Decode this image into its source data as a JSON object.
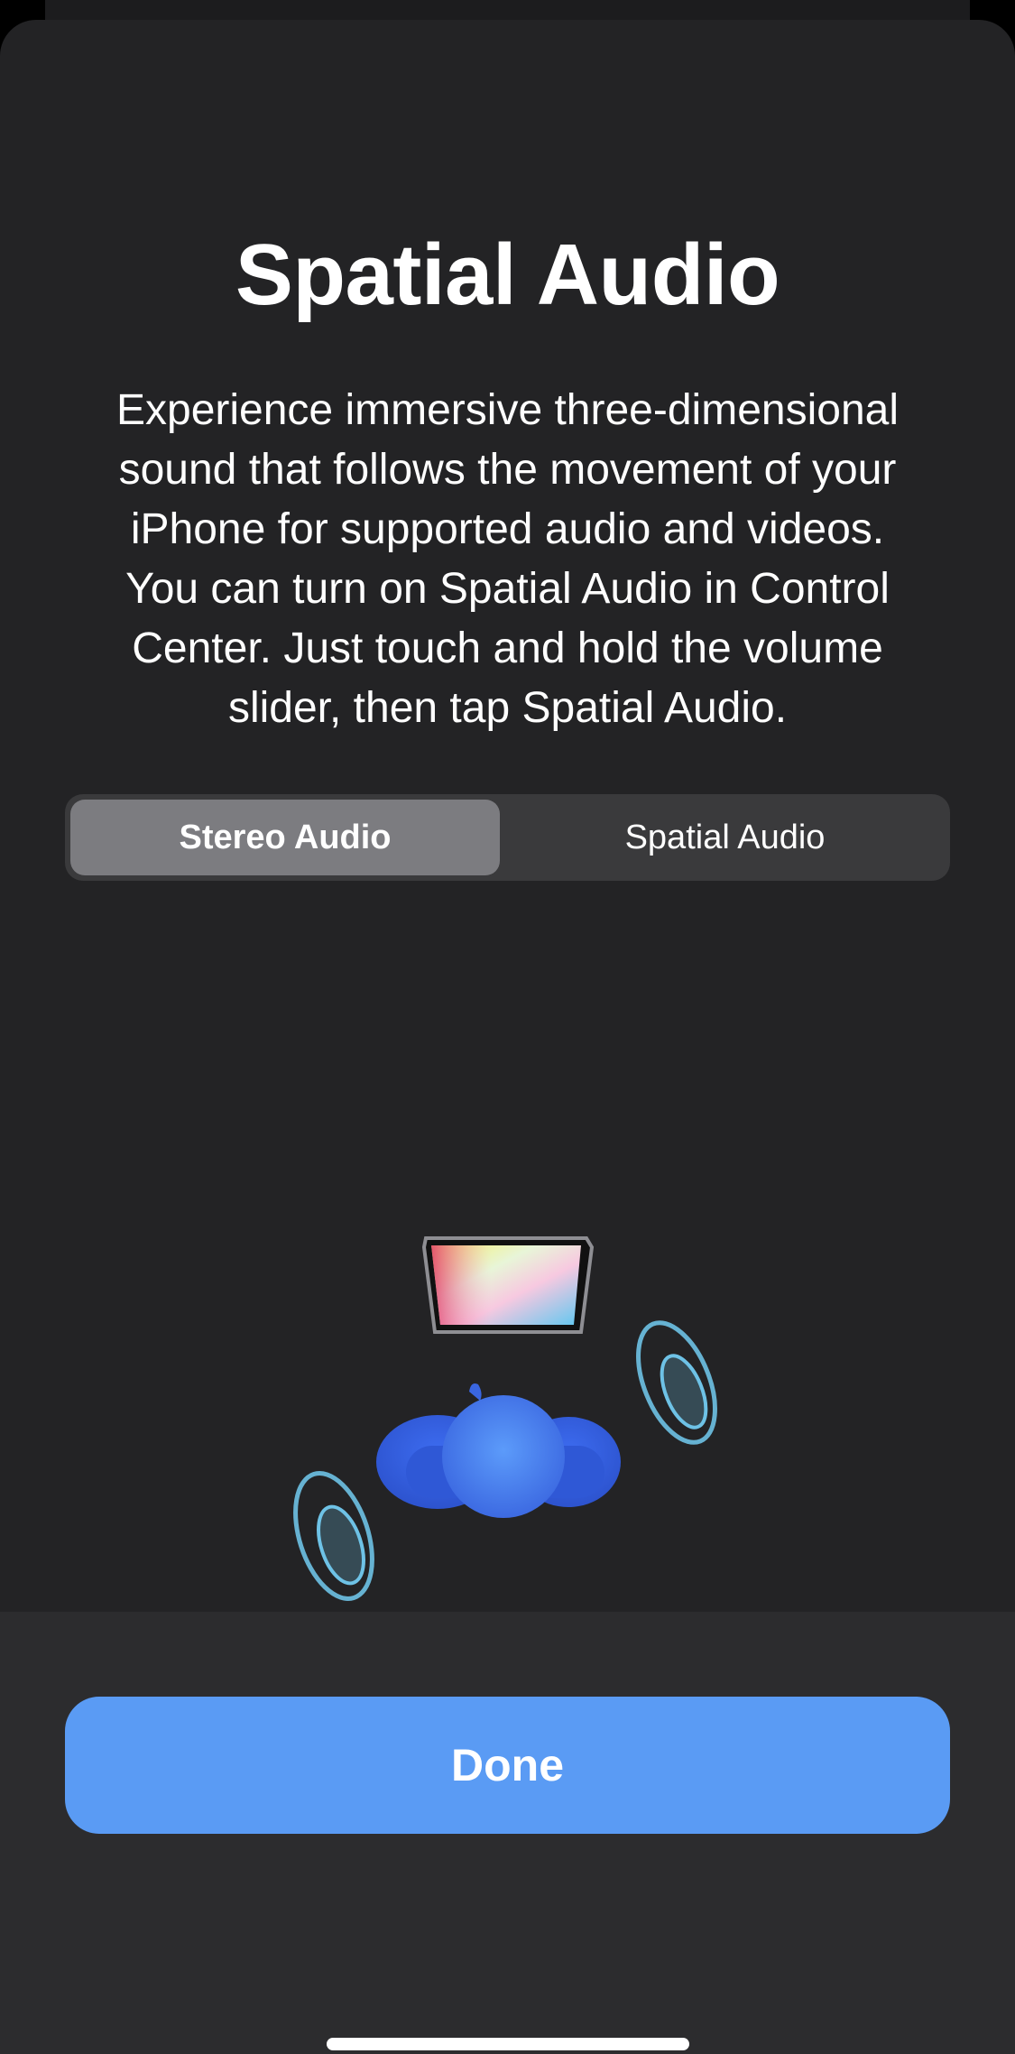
{
  "header": {
    "title": "Spatial Audio"
  },
  "description": {
    "lines": [
      "Experience immersive three-dimensional",
      "sound that follows the movement of your",
      "iPhone for supported audio and videos.",
      "You can turn on Spatial Audio in Control",
      "Center. Just touch and hold the volume",
      "slider, then tap Spatial Audio."
    ]
  },
  "segmented_control": {
    "options": [
      "Stereo Audio",
      "Spatial Audio"
    ],
    "selected": "Stereo Audio"
  },
  "illustration": {
    "icons": [
      "ipad-screen-icon",
      "listener-head-icon",
      "sound-wave-left-icon",
      "sound-wave-right-icon"
    ]
  },
  "footer": {
    "done_label": "Done"
  },
  "colors": {
    "accent": "#5a9bf4",
    "sheet_background": "#232325",
    "segment_selected": "#7c7c80",
    "segment_track": "#3a3a3c"
  }
}
